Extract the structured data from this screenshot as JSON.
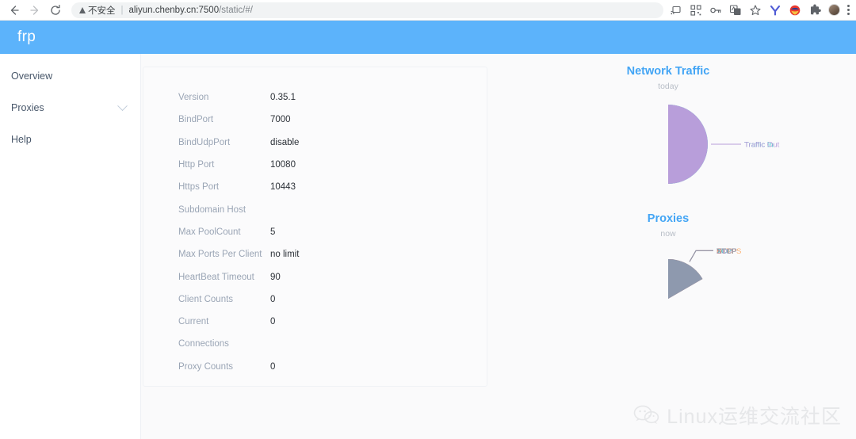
{
  "browser": {
    "back_icon": "back-arrow",
    "forward_icon": "forward-arrow",
    "reload_icon": "reload",
    "security_label": "不安全",
    "url_host": "aliyun.chenby.cn:7500",
    "url_path": "/static/#/",
    "separator": "|",
    "toolbar_icons": [
      "cast-icon",
      "qr-code-icon",
      "password-key-icon",
      "translate-icon",
      "bookmark-star-icon",
      "yandex-icon",
      "superhero-extension-icon",
      "puzzle-extension-icon",
      "profile-avatar",
      "kebab-menu-icon"
    ]
  },
  "header": {
    "logo": "frp"
  },
  "sidebar": {
    "items": [
      {
        "label": "Overview",
        "icon": "",
        "expandable": false
      },
      {
        "label": "Proxies",
        "icon": "chevron-down-icon",
        "expandable": true
      },
      {
        "label": "Help",
        "icon": "",
        "expandable": false
      }
    ]
  },
  "server_info": {
    "rows": [
      {
        "label": "Version",
        "value": "0.35.1"
      },
      {
        "label": "BindPort",
        "value": "7000"
      },
      {
        "label": "BindUdpPort",
        "value": "disable"
      },
      {
        "label": "Http Port",
        "value": "10080"
      },
      {
        "label": "Https Port",
        "value": "10443"
      },
      {
        "label": "Subdomain Host",
        "value": ""
      },
      {
        "label": "Max PoolCount",
        "value": "5"
      },
      {
        "label": "Max Ports Per Client",
        "value": "no limit"
      },
      {
        "label": "HeartBeat Timeout",
        "value": "90"
      },
      {
        "label": "Client Counts",
        "value": "0"
      },
      {
        "label": "Current",
        "value": "0"
      },
      {
        "label": "Connections",
        "value": ""
      },
      {
        "label": "Proxy Counts",
        "value": "0"
      }
    ]
  },
  "chart_data": [
    {
      "type": "pie",
      "title": "Network Traffic",
      "subtitle": "today",
      "legend_position": "labels-outside",
      "categories": [
        "Traffic In",
        "Traffic Out"
      ],
      "values": [
        50,
        50
      ],
      "colors": [
        "#2bc9c4",
        "#b89eda"
      ],
      "start_angle": 0
    },
    {
      "type": "pie",
      "title": "Proxies",
      "subtitle": "now",
      "legend_position": "labels-outside",
      "categories": [
        "TCP",
        "UDP",
        "HTTP",
        "HTTPS",
        "STCP",
        "XTCP"
      ],
      "values": [
        1,
        1,
        1,
        1,
        1,
        1
      ],
      "colors": [
        "#2bc9c4",
        "#b3a2de",
        "#5aaeee",
        "#fcb375",
        "#d9797d",
        "#8e99ae"
      ],
      "start_angle": 0
    }
  ],
  "watermark": {
    "text": "Linux运维交流社区",
    "icon": "wechat-icon"
  }
}
